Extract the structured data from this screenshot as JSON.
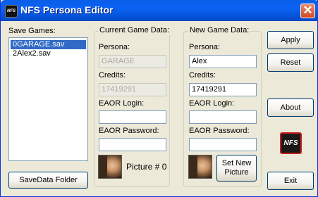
{
  "window": {
    "title": "NFS Persona Editor",
    "close_glyph": "✕",
    "app_icon": "NFS"
  },
  "save_games": {
    "label": "Save Games:",
    "items": [
      "0GARAGE.sav",
      "2Alex2.sav"
    ],
    "selected_index": 0,
    "folder_button": "SaveData Folder"
  },
  "current": {
    "title": "Current Game Data:",
    "persona_label": "Persona:",
    "persona_value": "GARAGE",
    "credits_label": "Credits:",
    "credits_value": "17419291",
    "eaor_login_label": "EAOR Login:",
    "eaor_login_value": "",
    "eaor_password_label": "EAOR Password:",
    "eaor_password_value": "",
    "picture_text": "Picture #  0"
  },
  "new": {
    "title": "New Game Data:",
    "persona_label": "Persona:",
    "persona_value": "Alex",
    "credits_label": "Credits:",
    "credits_value": "17419291",
    "eaor_login_label": "EAOR Login:",
    "eaor_login_value": "",
    "eaor_password_label": "EAOR Password:",
    "eaor_password_value": "",
    "set_picture_line1": "Set New",
    "set_picture_line2": "Picture"
  },
  "buttons": {
    "apply": "Apply",
    "reset": "Reset",
    "about": "About",
    "exit": "Exit"
  },
  "logo": {
    "text": "NFS"
  }
}
